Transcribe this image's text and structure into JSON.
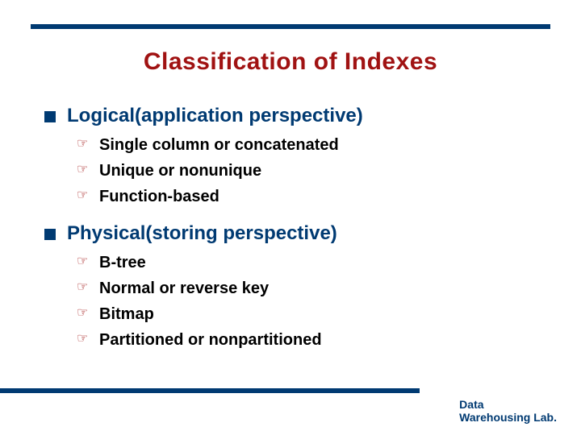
{
  "title": "Classification of Indexes",
  "sections": [
    {
      "heading": "Logical(application perspective)",
      "items": [
        "Single column or concatenated",
        "Unique or nonunique",
        "Function-based"
      ]
    },
    {
      "heading": "Physical(storing perspective)",
      "items": [
        "B-tree",
        "Normal or reverse key",
        "Bitmap",
        "Partitioned or nonpartitioned"
      ]
    }
  ],
  "footer_line1": "Data",
  "footer_line2": "Warehousing Lab.",
  "glyphs": {
    "pointer": "☞"
  }
}
